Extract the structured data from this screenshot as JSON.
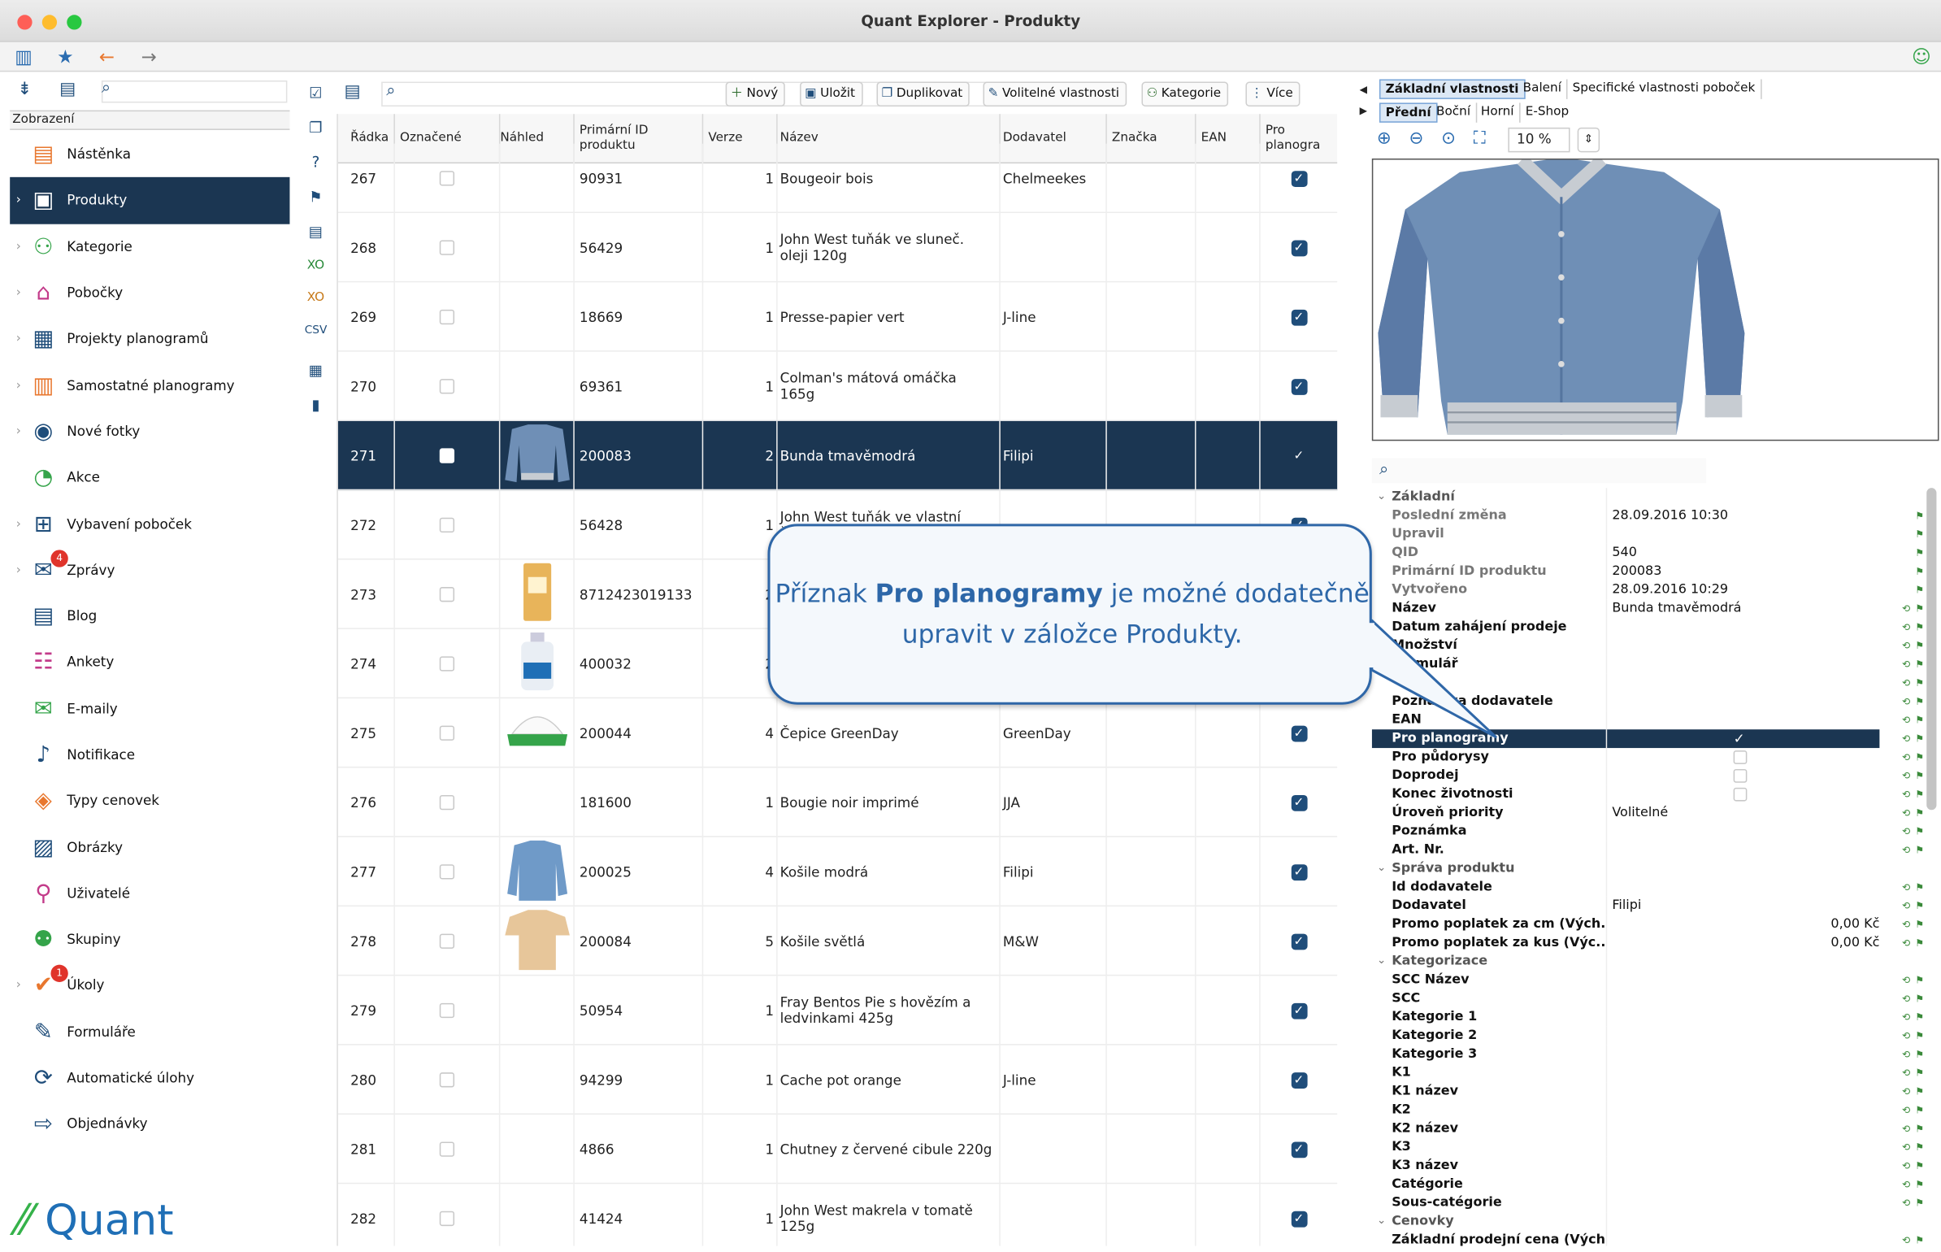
{
  "window": {
    "title": "Quant Explorer - Produkty"
  },
  "sidebar": {
    "section_label": "Zobrazení",
    "items": [
      {
        "label": "Nástěnka",
        "icon": "dashboard-icon"
      },
      {
        "label": "Produkty",
        "icon": "products-icon"
      },
      {
        "label": "Kategorie",
        "icon": "categories-icon"
      },
      {
        "label": "Pobočky",
        "icon": "stores-icon"
      },
      {
        "label": "Projekty planogramů",
        "icon": "planogram-projects-icon"
      },
      {
        "label": "Samostatné planogramy",
        "icon": "planograms-icon"
      },
      {
        "label": "Nové fotky",
        "icon": "camera-icon"
      },
      {
        "label": "Akce",
        "icon": "clock-icon"
      },
      {
        "label": "Vybavení poboček",
        "icon": "equipment-icon"
      },
      {
        "label": "Zprávy",
        "icon": "messages-icon",
        "badge": "4"
      },
      {
        "label": "Blog",
        "icon": "blog-icon"
      },
      {
        "label": "Ankety",
        "icon": "polls-icon"
      },
      {
        "label": "E-maily",
        "icon": "email-icon"
      },
      {
        "label": "Notifikace",
        "icon": "bell-icon"
      },
      {
        "label": "Typy cenovek",
        "icon": "price-tag-icon"
      },
      {
        "label": "Obrázky",
        "icon": "images-icon"
      },
      {
        "label": "Uživatelé",
        "icon": "user-icon"
      },
      {
        "label": "Skupiny",
        "icon": "groups-icon"
      },
      {
        "label": "Úkoly",
        "icon": "tasks-icon",
        "badge": "1"
      },
      {
        "label": "Formuláře",
        "icon": "forms-icon"
      },
      {
        "label": "Automatické úlohy",
        "icon": "auto-tasks-icon"
      },
      {
        "label": "Objednávky",
        "icon": "orders-icon"
      }
    ],
    "logo": "Quant"
  },
  "table_toolbar": {
    "new": "Nový",
    "save": "Uložit",
    "duplicate": "Duplikovat",
    "optional_props": "Volitelné vlastnosti",
    "categories": "Kategorie",
    "more": "Více"
  },
  "table": {
    "headers": [
      "Řádka",
      "Označené",
      "Náhled",
      "Primární ID produktu",
      "Verze",
      "Název",
      "Dodavatel",
      "Značka",
      "EAN",
      "Pro planogra"
    ],
    "rows": [
      {
        "r": "267",
        "id": "90931",
        "v": "1",
        "name": "Bougeoir bois",
        "sup": "Chelmeekes",
        "pp": true
      },
      {
        "r": "268",
        "id": "56429",
        "v": "1",
        "name": "John West tuňák ve sluneč. oleji 120g",
        "sup": "",
        "pp": true
      },
      {
        "r": "269",
        "id": "18669",
        "v": "1",
        "name": "Presse-papier vert",
        "sup": "J-line",
        "pp": true
      },
      {
        "r": "270",
        "id": "69361",
        "v": "1",
        "name": "Colman's mátová omáčka 165g",
        "sup": "",
        "pp": true
      },
      {
        "r": "271",
        "id": "200083",
        "v": "2",
        "name": "Bunda tmavěmodrá",
        "sup": "Filipi",
        "pp": true,
        "sel": true,
        "thumb": "jacket"
      },
      {
        "r": "272",
        "id": "56428",
        "v": "1",
        "name": "John West tuňák ve vlastní šťávě 120g",
        "sup": "",
        "pp": true
      },
      {
        "r": "273",
        "id": "8712423019133",
        "v": "2",
        "name": "",
        "sup": "",
        "pp": true,
        "thumb": "bag"
      },
      {
        "r": "274",
        "id": "400032",
        "v": "2",
        "name": "",
        "sup": "",
        "pp": true,
        "thumb": "bottle"
      },
      {
        "r": "275",
        "id": "200044",
        "v": "4",
        "name": "Čepice GreenDay",
        "sup": "GreenDay",
        "pp": true,
        "thumb": "cap"
      },
      {
        "r": "276",
        "id": "181600",
        "v": "1",
        "name": "Bougie noir imprimé",
        "sup": "JJA",
        "pp": true
      },
      {
        "r": "277",
        "id": "200025",
        "v": "4",
        "name": "Košile modrá",
        "sup": "Filipi",
        "pp": true,
        "thumb": "shirt-blue"
      },
      {
        "r": "278",
        "id": "200084",
        "v": "5",
        "name": "Košile světlá",
        "sup": "M&W",
        "pp": true,
        "thumb": "shirt-beige"
      },
      {
        "r": "279",
        "id": "50954",
        "v": "1",
        "name": "Fray Bentos Pie s hovězím a ledvinkami 425g",
        "sup": "",
        "pp": true
      },
      {
        "r": "280",
        "id": "94299",
        "v": "1",
        "name": "Cache pot orange",
        "sup": "J-line",
        "pp": true
      },
      {
        "r": "281",
        "id": "4866",
        "v": "1",
        "name": "Chutney z červené cibule 220g",
        "sup": "",
        "pp": true
      },
      {
        "r": "282",
        "id": "41424",
        "v": "1",
        "name": "John West makrela v tomatě 125g",
        "sup": "",
        "pp": true
      }
    ]
  },
  "preview": {
    "tabs_top": [
      "Základní vlastnosti",
      "Balení",
      "Specifické vlastnosti poboček"
    ],
    "tabs_views": [
      "Přední",
      "Boční",
      "Horní",
      "E-Shop"
    ],
    "zoom": "10 %"
  },
  "properties": [
    {
      "t": "g",
      "k": "Základní"
    },
    {
      "k": "Poslední změna",
      "v": "28.09.2016 10:30",
      "grey": true
    },
    {
      "k": "Upravil",
      "v": "",
      "grey": true
    },
    {
      "k": "QID",
      "v": "540",
      "grey": true
    },
    {
      "k": "Primární ID produktu",
      "v": "200083",
      "grey": true
    },
    {
      "k": "Vytvořeno",
      "v": "28.09.2016 10:29",
      "grey": true
    },
    {
      "k": "Název",
      "v": "Bunda tmavěmodrá"
    },
    {
      "k": "Datum zahájení prodeje",
      "v": ""
    },
    {
      "k": "Množství",
      "v": ""
    },
    {
      "k": "Formulář",
      "v": ""
    },
    {
      "k": "",
      "v": ""
    },
    {
      "k": "Poznámka dodavatele",
      "v": ""
    },
    {
      "k": "EAN",
      "v": ""
    },
    {
      "k": "Pro planogramy",
      "cb": "on",
      "hl": true
    },
    {
      "k": "Pro půdorysy",
      "cb": "off"
    },
    {
      "k": "Doprodej",
      "cb": "off"
    },
    {
      "k": "Konec životnosti",
      "cb": "off"
    },
    {
      "k": "Úroveň priority",
      "v": "Volitelné"
    },
    {
      "k": "Poznámka",
      "v": ""
    },
    {
      "k": "Art. Nr.",
      "v": ""
    },
    {
      "t": "g",
      "k": "Správa produktu"
    },
    {
      "k": "Id dodavatele",
      "v": ""
    },
    {
      "k": "Dodavatel",
      "v": "Filipi"
    },
    {
      "k": "Promo poplatek za cm (Vých...",
      "v": "0,00 Kč"
    },
    {
      "k": "Promo poplatek za kus (Výc...",
      "v": "0,00 Kč"
    },
    {
      "t": "g",
      "k": "Kategorizace"
    },
    {
      "k": "SCC Název",
      "v": ""
    },
    {
      "k": "SCC",
      "v": ""
    },
    {
      "k": "Kategorie 1",
      "v": ""
    },
    {
      "k": "Kategorie 2",
      "v": ""
    },
    {
      "k": "Kategorie 3",
      "v": ""
    },
    {
      "k": "K1",
      "v": ""
    },
    {
      "k": "K1 název",
      "v": ""
    },
    {
      "k": "K2",
      "v": ""
    },
    {
      "k": "K2 název",
      "v": ""
    },
    {
      "k": "K3",
      "v": ""
    },
    {
      "k": "K3 název",
      "v": ""
    },
    {
      "k": "Catégorie",
      "v": ""
    },
    {
      "k": "Sous-catégorie",
      "v": ""
    },
    {
      "t": "g",
      "k": "Cenovky"
    },
    {
      "k": "Základní prodejní cena (Vých...",
      "v": ""
    }
  ],
  "callout": {
    "pre": "Příznak ",
    "bold": "Pro planogramy",
    "post": " je možné dodatečně upravit v záložce Produkty."
  }
}
